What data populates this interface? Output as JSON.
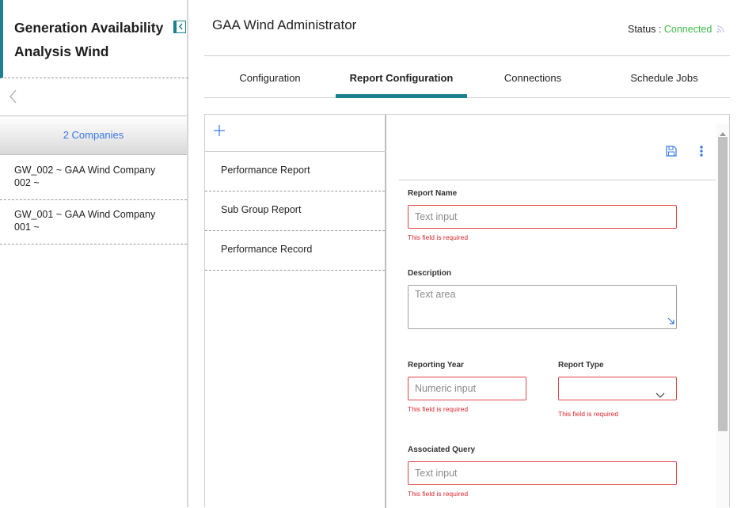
{
  "sidebar": {
    "title": "Generation Availability Analysis Wind",
    "companies_label": "2 Companies",
    "items": [
      {
        "label": "GW_002 ~ GAA Wind Company 002 ~"
      },
      {
        "label": "GW_001 ~ GAA Wind Company 001 ~"
      }
    ]
  },
  "header": {
    "title": "GAA Wind Administrator",
    "status_label": "Status : ",
    "status_value": "Connected"
  },
  "tabs": [
    {
      "label": "Configuration",
      "active": false
    },
    {
      "label": "Report Configuration",
      "active": true
    },
    {
      "label": "Connections",
      "active": false
    },
    {
      "label": "Schedule Jobs",
      "active": false
    }
  ],
  "reports": [
    {
      "label": "Performance Report"
    },
    {
      "label": "Sub Group Report"
    },
    {
      "label": "Performance Record"
    }
  ],
  "form": {
    "report_name": {
      "label": "Report Name",
      "placeholder": "Text input",
      "error": "This field is required"
    },
    "description": {
      "label": "Description",
      "placeholder": "Text area"
    },
    "reporting_year": {
      "label": "Reporting Year",
      "placeholder": "Numeric input",
      "error": "This field is required"
    },
    "report_type": {
      "label": "Report Type",
      "value": "",
      "error": "This field is required"
    },
    "associated_query": {
      "label": "Associated Query",
      "placeholder": "Text input",
      "error": "This field is required"
    }
  },
  "icons": {
    "collapse": "collapse-sidebar-icon",
    "back": "chevron-left-icon",
    "add": "plus-icon",
    "save": "save-icon",
    "more": "more-vertical-icon",
    "status": "rss-icon",
    "dropdown": "chevron-down-icon"
  },
  "colors": {
    "accent": "#1b8190",
    "link": "#3b78e7",
    "connected": "#3dba47",
    "error": "#d8262d"
  }
}
